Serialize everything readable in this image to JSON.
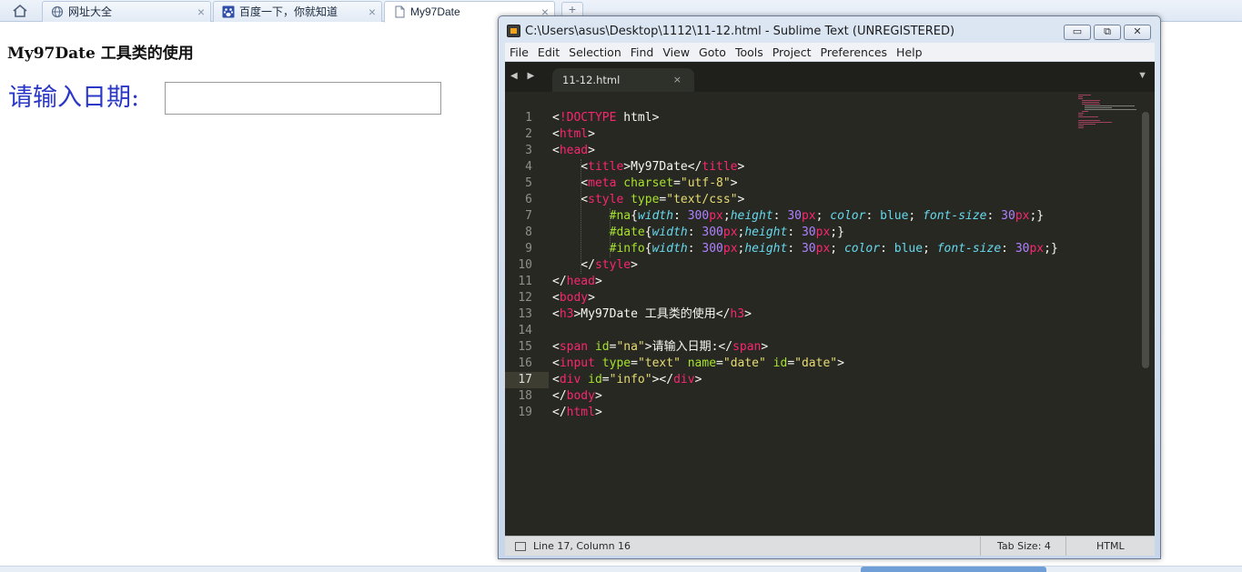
{
  "browser": {
    "tabs": [
      {
        "label": "网址大全",
        "icon": "globe-icon",
        "close": "×"
      },
      {
        "label": "百度一下，你就知道",
        "icon": "baidu-paw-icon",
        "close": "×"
      },
      {
        "label": "My97Date",
        "icon": "page-icon",
        "close": "×",
        "active": true
      }
    ],
    "new_tab_symbol": "+"
  },
  "page": {
    "heading": "My97Date 工具类的使用",
    "date_label": "请输入日期:",
    "date_input_value": ""
  },
  "editor": {
    "title": "C:\\Users\\asus\\Desktop\\1112\\11-12.html - Sublime Text (UNREGISTERED)",
    "window_buttons": {
      "minimize": "▭",
      "maximize": "⧉",
      "close": "✕"
    },
    "menu": [
      "File",
      "Edit",
      "Selection",
      "Find",
      "View",
      "Goto",
      "Tools",
      "Project",
      "Preferences",
      "Help"
    ],
    "nav_arrows": "◀ ▶",
    "file_tab": {
      "name": "11-12.html",
      "close": "×"
    },
    "tabs_dropdown": "▼",
    "line_numbers": [
      "1",
      "2",
      "3",
      "4",
      "5",
      "6",
      "7",
      "8",
      "9",
      "10",
      "11",
      "12",
      "13",
      "14",
      "15",
      "16",
      "17",
      "18",
      "19"
    ],
    "current_line": 17,
    "code": [
      "<!DOCTYPE html>",
      "<html>",
      "<head>",
      "    <title>My97Date</title>",
      "    <meta charset=\"utf-8\">",
      "    <style type=\"text/css\">",
      "        #na{width: 300px;height: 30px; color: blue; font-size: 30px;}",
      "        #date{width: 300px;height: 30px;}",
      "        #info{width: 300px;height: 30px; color: blue; font-size: 30px;}",
      "    </style>",
      "</head>",
      "<body>",
      "<h3>My97Date 工具类的使用</h3>",
      "",
      "<span id=\"na\">请输入日期:</span>",
      "<input type=\"text\" name=\"date\" id=\"date\">",
      "<div id=\"info\"></div>",
      "</body>",
      "</html>"
    ],
    "status": {
      "cursor": "Line 17, Column 16",
      "tab_size": "Tab Size: 4",
      "syntax": "HTML"
    },
    "colors": {
      "background": "#272822",
      "tag": "#f92672",
      "attribute": "#a6e22e",
      "string": "#e6db74",
      "number": "#ae81ff",
      "property": "#66d9ef"
    }
  }
}
